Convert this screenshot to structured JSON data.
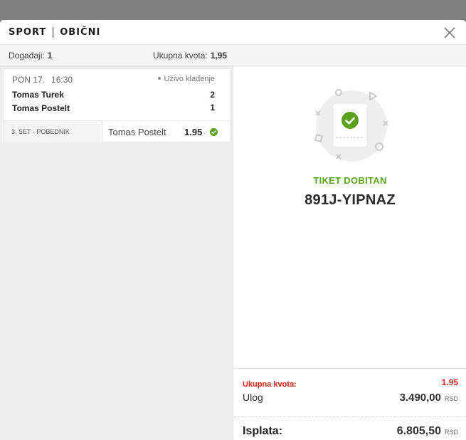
{
  "header": {
    "category": "SPORT",
    "ticket_type": "OBIČNI"
  },
  "info": {
    "events_label": "Događaji:",
    "events_count": "1",
    "total_odds_label": "Ukupna kvota:",
    "total_odds_value": "1,95"
  },
  "event": {
    "day": "PON 17.",
    "time": "16:30",
    "live_label": "Uživo klađenje",
    "home_team": "Tomas Turek",
    "away_team": "Tomas Postelt",
    "home_score": "2",
    "away_score": "1",
    "market": "3. SET - POBEDNIK",
    "selection": "Tomas Postelt",
    "odds": "1.95",
    "status_icon": "check-circle-icon"
  },
  "result": {
    "status_label": "TIKET DOBITAN",
    "ticket_code": "891J-YIPNAZ"
  },
  "summary": {
    "total_odds_label": "Ukupna kvota:",
    "total_odds_value": "1.95",
    "stake_label": "Ulog",
    "stake_value": "3.490,00",
    "payout_label": "Isplata:",
    "payout_value": "6.805,50",
    "currency": "RSD"
  },
  "colors": {
    "win_green": "#5da21e",
    "accent_red": "#e0201f",
    "backdrop": "#808080"
  }
}
